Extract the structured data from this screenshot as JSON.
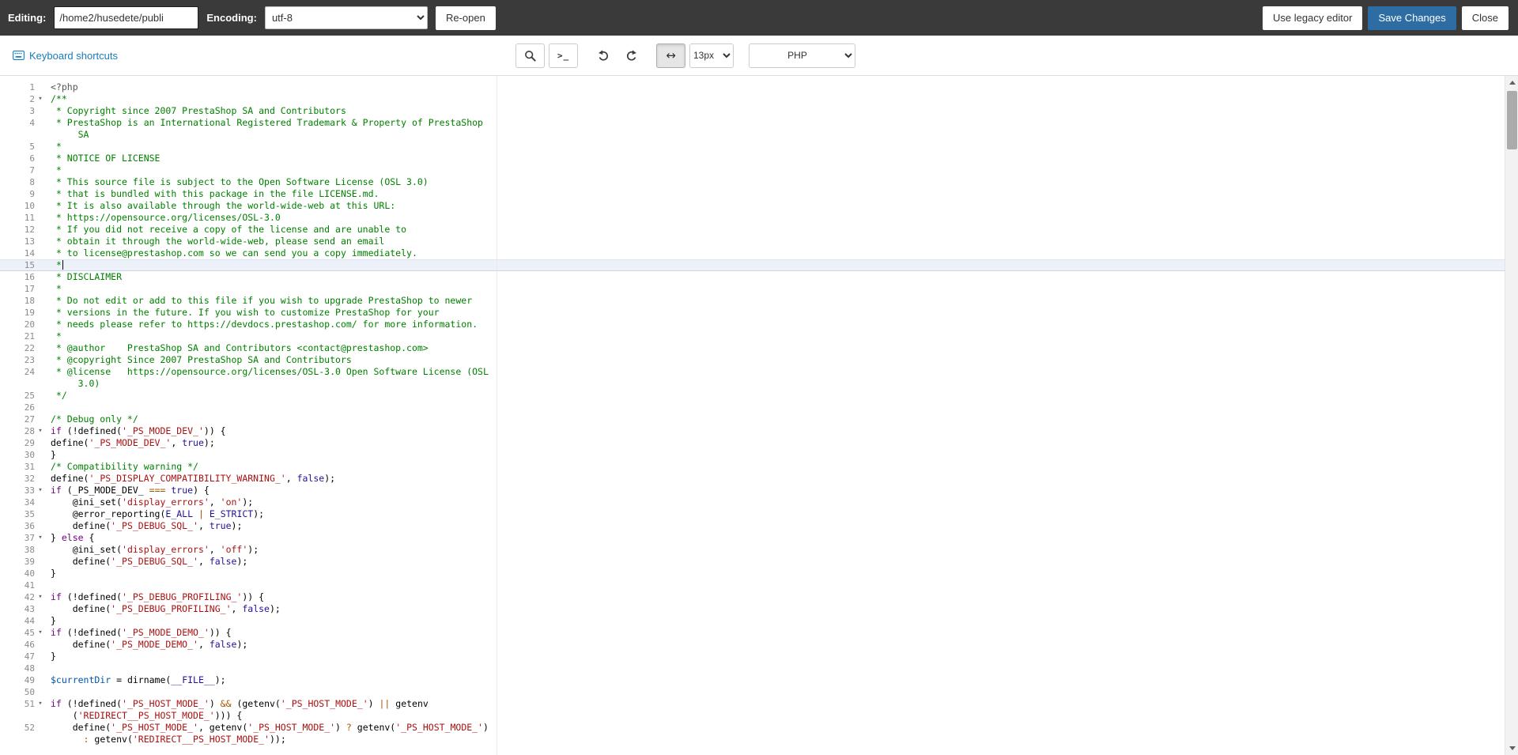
{
  "colors": {
    "accent": "#2e6da4",
    "link": "#1a7bb9",
    "comment": "#008000",
    "string": "#aa1111",
    "atom": "#221199",
    "keyword": "#770088",
    "variable": "#0055aa",
    "operator": "#aa5500",
    "meta": "#555555"
  },
  "topbar": {
    "editing_label": "Editing:",
    "path_value": "/home2/husedete/publi",
    "encoding_label": "Encoding:",
    "encoding_selected": "utf-8",
    "reopen_label": "Re-open",
    "legacy_label": "Use legacy editor",
    "save_label": "Save Changes",
    "close_label": "Close"
  },
  "toolbar": {
    "shortcuts_label": "Keyboard shortcuts",
    "command_glyph": ">_",
    "wrap_glyph": "↔",
    "font_size_selected": "13px",
    "language_selected": "PHP"
  },
  "editor": {
    "active_line": 15,
    "fold_glyph": "▾",
    "lines": [
      {
        "n": 1,
        "rows": [
          [
            [
              "m",
              "<?php"
            ]
          ]
        ]
      },
      {
        "n": 2,
        "fold": 1,
        "rows": [
          [
            [
              "c",
              "/**"
            ]
          ]
        ]
      },
      {
        "n": 3,
        "rows": [
          [
            [
              "c",
              " * Copyright since 2007 PrestaShop SA and Contributors"
            ]
          ]
        ]
      },
      {
        "n": 4,
        "rows": [
          [
            [
              "c",
              " * PrestaShop is an International Registered Trademark & Property of PrestaShop"
            ]
          ],
          [
            [
              "c",
              "     SA"
            ]
          ]
        ]
      },
      {
        "n": 5,
        "rows": [
          [
            [
              "c",
              " *"
            ]
          ]
        ]
      },
      {
        "n": 6,
        "rows": [
          [
            [
              "c",
              " * NOTICE OF LICENSE"
            ]
          ]
        ]
      },
      {
        "n": 7,
        "rows": [
          [
            [
              "c",
              " *"
            ]
          ]
        ]
      },
      {
        "n": 8,
        "rows": [
          [
            [
              "c",
              " * This source file is subject to the Open Software License (OSL 3.0)"
            ]
          ]
        ]
      },
      {
        "n": 9,
        "rows": [
          [
            [
              "c",
              " * that is bundled with this package in the file LICENSE.md."
            ]
          ]
        ]
      },
      {
        "n": 10,
        "rows": [
          [
            [
              "c",
              " * It is also available through the world-wide-web at this URL:"
            ]
          ]
        ]
      },
      {
        "n": 11,
        "rows": [
          [
            [
              "c",
              " * https://opensource.org/licenses/OSL-3.0"
            ]
          ]
        ]
      },
      {
        "n": 12,
        "rows": [
          [
            [
              "c",
              " * If you did not receive a copy of the license and are unable to"
            ]
          ]
        ]
      },
      {
        "n": 13,
        "rows": [
          [
            [
              "c",
              " * obtain it through the world-wide-web, please send an email"
            ]
          ]
        ]
      },
      {
        "n": 14,
        "rows": [
          [
            [
              "c",
              " * to license@prestashop.com so we can send you a copy immediately."
            ]
          ]
        ]
      },
      {
        "n": 15,
        "active": 1,
        "cursor": 1,
        "rows": [
          [
            [
              "c",
              " *"
            ]
          ]
        ]
      },
      {
        "n": 16,
        "rows": [
          [
            [
              "c",
              " * DISCLAIMER"
            ]
          ]
        ]
      },
      {
        "n": 17,
        "rows": [
          [
            [
              "c",
              " *"
            ]
          ]
        ]
      },
      {
        "n": 18,
        "rows": [
          [
            [
              "c",
              " * Do not edit or add to this file if you wish to upgrade PrestaShop to newer"
            ]
          ]
        ]
      },
      {
        "n": 19,
        "rows": [
          [
            [
              "c",
              " * versions in the future. If you wish to customize PrestaShop for your"
            ]
          ]
        ]
      },
      {
        "n": 20,
        "rows": [
          [
            [
              "c",
              " * needs please refer to https://devdocs.prestashop.com/ for more information."
            ]
          ]
        ]
      },
      {
        "n": 21,
        "rows": [
          [
            [
              "c",
              " *"
            ]
          ]
        ]
      },
      {
        "n": 22,
        "rows": [
          [
            [
              "c",
              " * @author    PrestaShop SA and Contributors <contact@prestashop.com>"
            ]
          ]
        ]
      },
      {
        "n": 23,
        "rows": [
          [
            [
              "c",
              " * @copyright Since 2007 PrestaShop SA and Contributors"
            ]
          ]
        ]
      },
      {
        "n": 24,
        "rows": [
          [
            [
              "c",
              " * @license   https://opensource.org/licenses/OSL-3.0 Open Software License (OSL"
            ]
          ],
          [
            [
              "c",
              "     3.0)"
            ]
          ]
        ]
      },
      {
        "n": 25,
        "rows": [
          [
            [
              "c",
              " */"
            ]
          ]
        ]
      },
      {
        "n": 26,
        "rows": [
          []
        ]
      },
      {
        "n": 27,
        "rows": [
          [
            [
              "c",
              "/* Debug only */"
            ]
          ]
        ]
      },
      {
        "n": 28,
        "fold": 1,
        "rows": [
          [
            [
              "k",
              "if"
            ],
            [
              "p",
              " (!defined("
            ],
            [
              "s",
              "'_PS_MODE_DEV_'"
            ],
            [
              "p",
              ")) {"
            ]
          ]
        ]
      },
      {
        "n": 29,
        "rows": [
          [
            [
              "p",
              "define("
            ],
            [
              "s",
              "'_PS_MODE_DEV_'"
            ],
            [
              "p",
              ", "
            ],
            [
              "a",
              "true"
            ],
            [
              "p",
              ");"
            ]
          ]
        ]
      },
      {
        "n": 30,
        "rows": [
          [
            [
              "p",
              "}"
            ]
          ]
        ]
      },
      {
        "n": 31,
        "rows": [
          [
            [
              "c",
              "/* Compatibility warning */"
            ]
          ]
        ]
      },
      {
        "n": 32,
        "rows": [
          [
            [
              "p",
              "define("
            ],
            [
              "s",
              "'_PS_DISPLAY_COMPATIBILITY_WARNING_'"
            ],
            [
              "p",
              ", "
            ],
            [
              "a",
              "false"
            ],
            [
              "p",
              ");"
            ]
          ]
        ]
      },
      {
        "n": 33,
        "fold": 1,
        "rows": [
          [
            [
              "k",
              "if"
            ],
            [
              "p",
              " (_PS_MODE_DEV_ "
            ],
            [
              "o",
              "==="
            ],
            [
              "p",
              " "
            ],
            [
              "a",
              "true"
            ],
            [
              "p",
              ") {"
            ]
          ]
        ]
      },
      {
        "n": 34,
        "rows": [
          [
            [
              "p",
              "    @ini_set("
            ],
            [
              "s",
              "'display_errors'"
            ],
            [
              "p",
              ", "
            ],
            [
              "s",
              "'on'"
            ],
            [
              "p",
              ");"
            ]
          ]
        ]
      },
      {
        "n": 35,
        "rows": [
          [
            [
              "p",
              "    @error_reporting("
            ],
            [
              "a",
              "E_ALL"
            ],
            [
              "p",
              " "
            ],
            [
              "o",
              "|"
            ],
            [
              "p",
              " "
            ],
            [
              "a",
              "E_STRICT"
            ],
            [
              "p",
              ");"
            ]
          ]
        ]
      },
      {
        "n": 36,
        "rows": [
          [
            [
              "p",
              "    define("
            ],
            [
              "s",
              "'_PS_DEBUG_SQL_'"
            ],
            [
              "p",
              ", "
            ],
            [
              "a",
              "true"
            ],
            [
              "p",
              ");"
            ]
          ]
        ]
      },
      {
        "n": 37,
        "fold": 1,
        "rows": [
          [
            [
              "p",
              "} "
            ],
            [
              "k",
              "else"
            ],
            [
              "p",
              " {"
            ]
          ]
        ]
      },
      {
        "n": 38,
        "rows": [
          [
            [
              "p",
              "    @ini_set("
            ],
            [
              "s",
              "'display_errors'"
            ],
            [
              "p",
              ", "
            ],
            [
              "s",
              "'off'"
            ],
            [
              "p",
              ");"
            ]
          ]
        ]
      },
      {
        "n": 39,
        "rows": [
          [
            [
              "p",
              "    define("
            ],
            [
              "s",
              "'_PS_DEBUG_SQL_'"
            ],
            [
              "p",
              ", "
            ],
            [
              "a",
              "false"
            ],
            [
              "p",
              ");"
            ]
          ]
        ]
      },
      {
        "n": 40,
        "rows": [
          [
            [
              "p",
              "}"
            ]
          ]
        ]
      },
      {
        "n": 41,
        "rows": [
          []
        ]
      },
      {
        "n": 42,
        "fold": 1,
        "rows": [
          [
            [
              "k",
              "if"
            ],
            [
              "p",
              " (!defined("
            ],
            [
              "s",
              "'_PS_DEBUG_PROFILING_'"
            ],
            [
              "p",
              ")) {"
            ]
          ]
        ]
      },
      {
        "n": 43,
        "rows": [
          [
            [
              "p",
              "    define("
            ],
            [
              "s",
              "'_PS_DEBUG_PROFILING_'"
            ],
            [
              "p",
              ", "
            ],
            [
              "a",
              "false"
            ],
            [
              "p",
              ");"
            ]
          ]
        ]
      },
      {
        "n": 44,
        "rows": [
          [
            [
              "p",
              "}"
            ]
          ]
        ]
      },
      {
        "n": 45,
        "fold": 1,
        "rows": [
          [
            [
              "k",
              "if"
            ],
            [
              "p",
              " (!defined("
            ],
            [
              "s",
              "'_PS_MODE_DEMO_'"
            ],
            [
              "p",
              ")) {"
            ]
          ]
        ]
      },
      {
        "n": 46,
        "rows": [
          [
            [
              "p",
              "    define("
            ],
            [
              "s",
              "'_PS_MODE_DEMO_'"
            ],
            [
              "p",
              ", "
            ],
            [
              "a",
              "false"
            ],
            [
              "p",
              ");"
            ]
          ]
        ]
      },
      {
        "n": 47,
        "rows": [
          [
            [
              "p",
              "}"
            ]
          ]
        ]
      },
      {
        "n": 48,
        "rows": [
          []
        ]
      },
      {
        "n": 49,
        "rows": [
          [
            [
              "v",
              "$currentDir"
            ],
            [
              "p",
              " = dirname("
            ],
            [
              "a",
              "__FILE__"
            ],
            [
              "p",
              ");"
            ]
          ]
        ]
      },
      {
        "n": 50,
        "rows": [
          []
        ]
      },
      {
        "n": 51,
        "fold": 1,
        "rows": [
          [
            [
              "k",
              "if"
            ],
            [
              "p",
              " (!defined("
            ],
            [
              "s",
              "'_PS_HOST_MODE_'"
            ],
            [
              "p",
              ") "
            ],
            [
              "o",
              "&&"
            ],
            [
              "p",
              " (getenv("
            ],
            [
              "s",
              "'_PS_HOST_MODE_'"
            ],
            [
              "p",
              ") "
            ],
            [
              "o",
              "||"
            ],
            [
              "p",
              " getenv"
            ]
          ],
          [
            [
              "p",
              "    ("
            ],
            [
              "s",
              "'REDIRECT__PS_HOST_MODE_'"
            ],
            [
              "p",
              "))) {"
            ]
          ]
        ]
      },
      {
        "n": 52,
        "rows": [
          [
            [
              "p",
              "    define("
            ],
            [
              "s",
              "'_PS_HOST_MODE_'"
            ],
            [
              "p",
              ", getenv("
            ],
            [
              "s",
              "'_PS_HOST_MODE_'"
            ],
            [
              "p",
              ") "
            ],
            [
              "o",
              "?"
            ],
            [
              "p",
              " getenv("
            ],
            [
              "s",
              "'_PS_HOST_MODE_'"
            ],
            [
              "p",
              ")"
            ]
          ],
          [
            [
              "p",
              "      "
            ],
            [
              "o",
              ":"
            ],
            [
              "p",
              " getenv("
            ],
            [
              "s",
              "'REDIRECT__PS_HOST_MODE_'"
            ],
            [
              "p",
              "));"
            ]
          ]
        ]
      }
    ]
  }
}
